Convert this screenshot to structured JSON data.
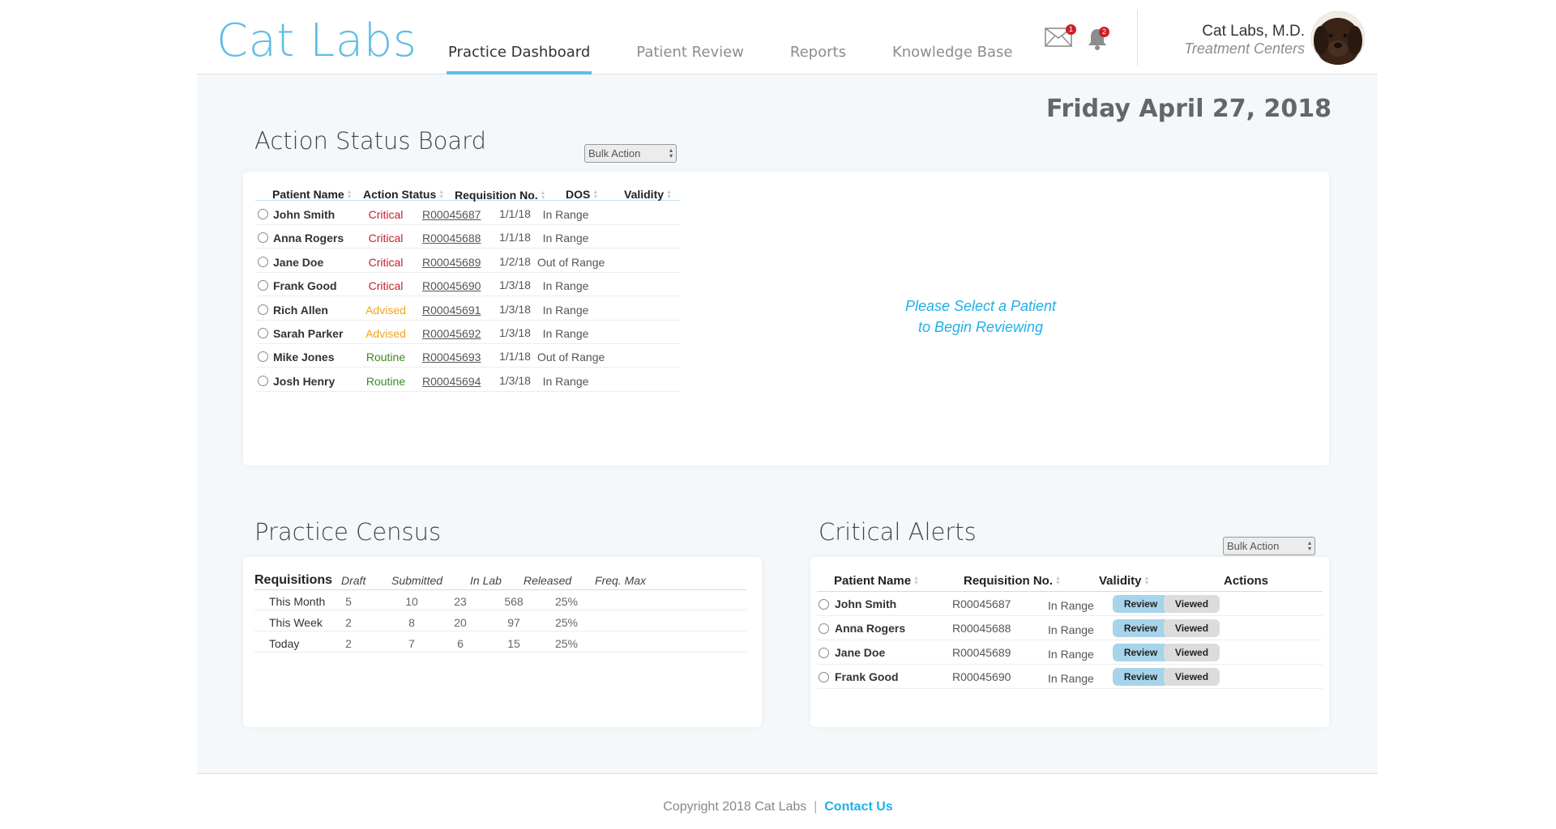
{
  "header": {
    "logo": "Cat Labs",
    "nav": [
      {
        "label": "Practice Dashboard",
        "active": true
      },
      {
        "label": "Patient Review",
        "active": false
      },
      {
        "label": "Reports",
        "active": false
      },
      {
        "label": "Knowledge Base",
        "active": false
      }
    ],
    "mail_count": "1",
    "notification_count": "2",
    "user_name": "Cat Labs, M.D.",
    "user_subtitle": "Treatment Centers"
  },
  "date": "Friday April 27, 2018",
  "action_board": {
    "title": "Action Status Board",
    "bulk_action": "Bulk Action",
    "columns": [
      "Patient Name",
      "Action Status",
      "Requisition No.",
      "DOS",
      "Validity"
    ],
    "rows": [
      {
        "name": "John Smith",
        "status": "Critical",
        "status_type": "critical",
        "req": "R00045687",
        "dos": "1/1/18",
        "validity": "In Range"
      },
      {
        "name": "Anna Rogers",
        "status": "Critical",
        "status_type": "critical",
        "req": "R00045688",
        "dos": "1/1/18",
        "validity": "In Range"
      },
      {
        "name": "Jane Doe",
        "status": "Critical",
        "status_type": "critical",
        "req": "R00045689",
        "dos": "1/2/18",
        "validity": "Out of Range"
      },
      {
        "name": "Frank Good",
        "status": "Critical",
        "status_type": "critical",
        "req": "R00045690",
        "dos": "1/3/18",
        "validity": "In Range"
      },
      {
        "name": "Rich Allen",
        "status": "Advised",
        "status_type": "advised",
        "req": "R00045691",
        "dos": "1/3/18",
        "validity": "In Range"
      },
      {
        "name": "Sarah Parker",
        "status": "Advised",
        "status_type": "advised",
        "req": "R00045692",
        "dos": "1/3/18",
        "validity": "In Range"
      },
      {
        "name": "Mike Jones",
        "status": "Routine",
        "status_type": "routine",
        "req": "R00045693",
        "dos": "1/1/18",
        "validity": "Out of Range"
      },
      {
        "name": "Josh Henry",
        "status": "Routine",
        "status_type": "routine",
        "req": "R00045694",
        "dos": "1/3/18",
        "validity": "In Range"
      }
    ],
    "placeholder_line1": "Please Select a Patient",
    "placeholder_line2": "to Begin Reviewing"
  },
  "census": {
    "title": "Practice Census",
    "row_header": "Requisitions",
    "columns": [
      "Draft",
      "Submitted",
      "In Lab",
      "Released",
      "Freq. Max"
    ],
    "rows": [
      {
        "label": "This Month",
        "values": [
          "5",
          "10",
          "23",
          "568",
          "25%"
        ]
      },
      {
        "label": "This Week",
        "values": [
          "2",
          "8",
          "20",
          "97",
          "25%"
        ]
      },
      {
        "label": "Today",
        "values": [
          "2",
          "7",
          "6",
          "15",
          "25%"
        ]
      }
    ]
  },
  "alerts": {
    "title": "Critical Alerts",
    "bulk_action": "Bulk Action",
    "columns": [
      "Patient Name",
      "Requisition No.",
      "Validity",
      "Actions"
    ],
    "review_label": "Review",
    "viewed_label": "Viewed",
    "rows": [
      {
        "name": "John Smith",
        "req": "R00045687",
        "validity": "In Range"
      },
      {
        "name": "Anna Rogers",
        "req": "R00045688",
        "validity": "In Range"
      },
      {
        "name": "Jane Doe",
        "req": "R00045689",
        "validity": "In Range"
      },
      {
        "name": "Frank Good",
        "req": "R00045690",
        "validity": "In Range"
      }
    ]
  },
  "footer": {
    "copyright": "Copyright 2018 Cat Labs",
    "separator": "|",
    "contact": "Contact Us"
  },
  "colors": {
    "accent": "#5fbde6",
    "critical": "#c51f2c",
    "advised": "#f0a31f",
    "routine": "#3a8a22",
    "link": "#1fb0e6"
  }
}
